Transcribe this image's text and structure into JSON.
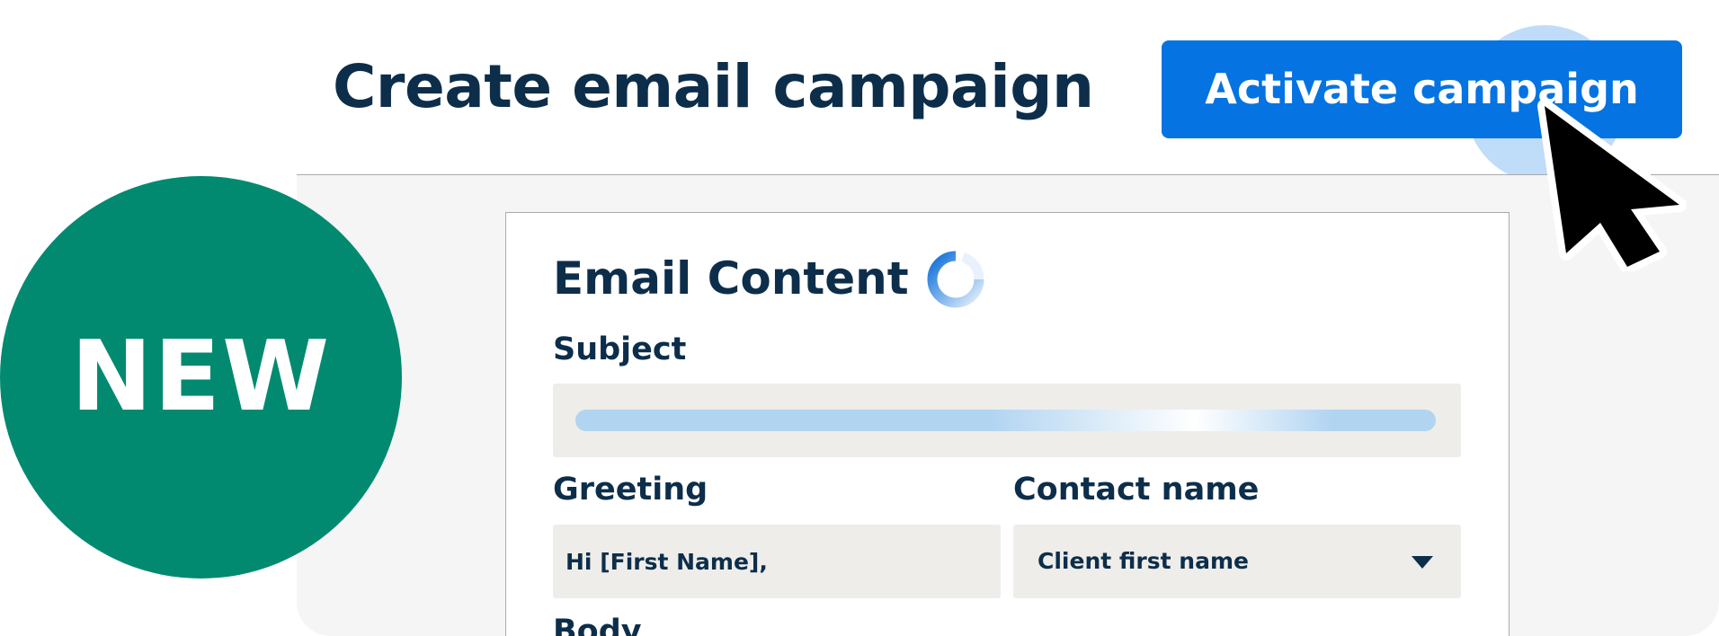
{
  "header": {
    "title": "Create email campaign",
    "activate_button_label": "Activate campaign"
  },
  "badge": {
    "label": "NEW"
  },
  "email_content": {
    "title": "Email Content",
    "subject_label": "Subject",
    "greeting_label": "Greeting",
    "greeting_value": "Hi [First Name],",
    "contact_name_label": "Contact name",
    "contact_name_selected": "Client first name",
    "body_label": "Body"
  },
  "icons": {
    "spinner": "loading-spinner-icon",
    "dropdown": "caret-down-icon",
    "pointer": "mouse-pointer-icon"
  },
  "colors": {
    "primary_button": "#0573e1",
    "title_text": "#0d2e4a",
    "badge": "#028a71",
    "field_background": "#eeedea",
    "workspace_background": "#f6f5f5",
    "skeleton": "#b1d4f1",
    "click_highlight": "#aad0f6"
  }
}
